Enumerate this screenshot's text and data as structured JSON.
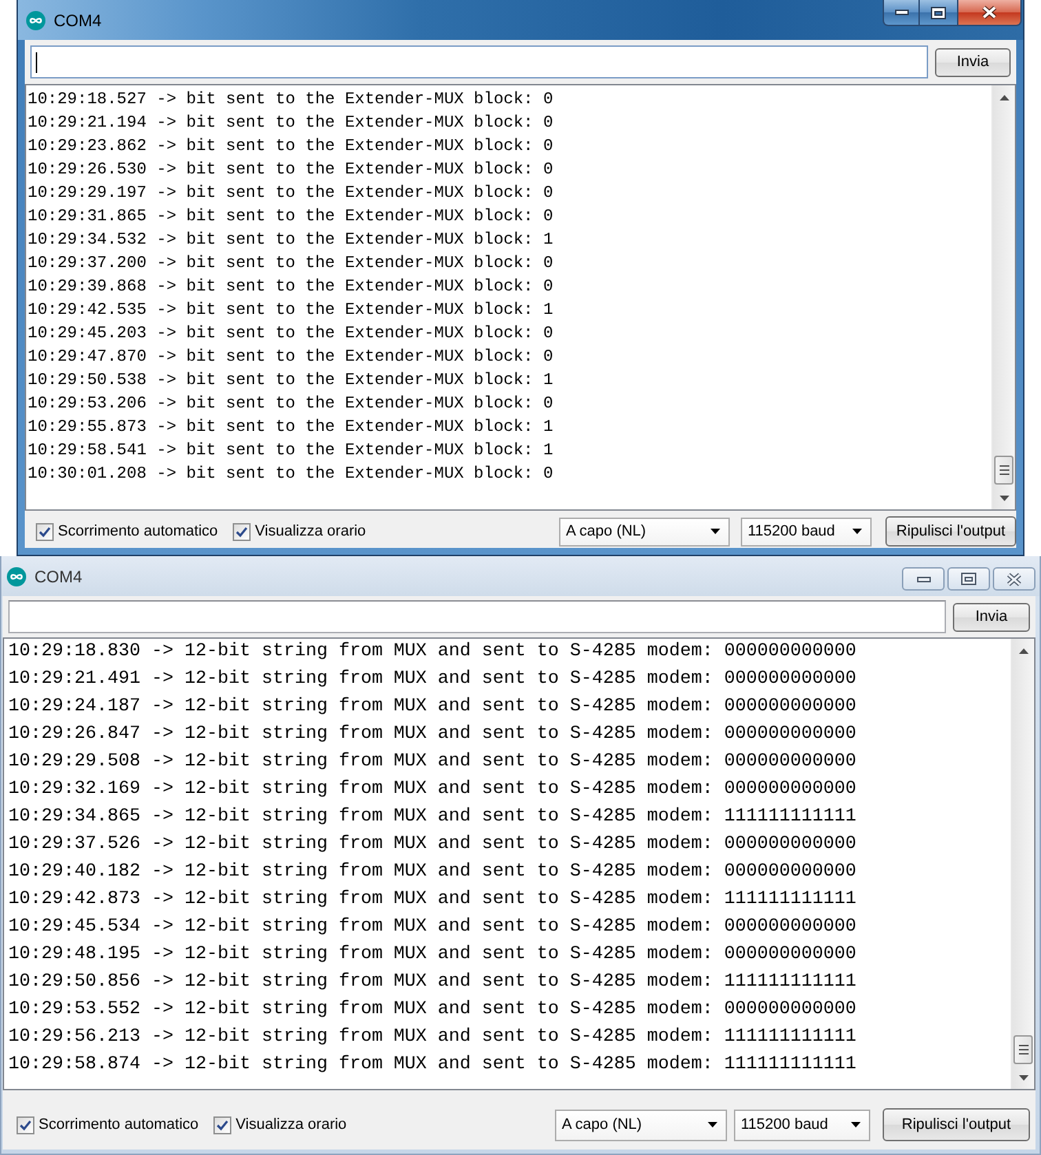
{
  "windows": [
    {
      "title": "COM4",
      "active": true,
      "input": {
        "focused": true
      },
      "send_button": "Invia",
      "output_lines": [
        "10:29:18.527 -> bit sent to the Extender-MUX block: 0",
        "10:29:21.194 -> bit sent to the Extender-MUX block: 0",
        "10:29:23.862 -> bit sent to the Extender-MUX block: 0",
        "10:29:26.530 -> bit sent to the Extender-MUX block: 0",
        "10:29:29.197 -> bit sent to the Extender-MUX block: 0",
        "10:29:31.865 -> bit sent to the Extender-MUX block: 0",
        "10:29:34.532 -> bit sent to the Extender-MUX block: 1",
        "10:29:37.200 -> bit sent to the Extender-MUX block: 0",
        "10:29:39.868 -> bit sent to the Extender-MUX block: 0",
        "10:29:42.535 -> bit sent to the Extender-MUX block: 1",
        "10:29:45.203 -> bit sent to the Extender-MUX block: 0",
        "10:29:47.870 -> bit sent to the Extender-MUX block: 0",
        "10:29:50.538 -> bit sent to the Extender-MUX block: 1",
        "10:29:53.206 -> bit sent to the Extender-MUX block: 0",
        "10:29:55.873 -> bit sent to the Extender-MUX block: 1",
        "10:29:58.541 -> bit sent to the Extender-MUX block: 1",
        "10:30:01.208 -> bit sent to the Extender-MUX block: 0"
      ],
      "autoscroll": {
        "label": "Scorrimento automatico",
        "checked": true
      },
      "show_timestamp": {
        "label": "Visualizza orario",
        "checked": true
      },
      "line_ending": "A capo (NL)",
      "baud_rate": "115200 baud",
      "clear_button": "Ripulisci l'output"
    },
    {
      "title": "COM4",
      "active": false,
      "input": {
        "focused": false
      },
      "send_button": "Invia",
      "output_lines": [
        "10:29:18.830 -> 12-bit string from MUX and sent to S-4285 modem: 000000000000",
        "10:29:21.491 -> 12-bit string from MUX and sent to S-4285 modem: 000000000000",
        "10:29:24.187 -> 12-bit string from MUX and sent to S-4285 modem: 000000000000",
        "10:29:26.847 -> 12-bit string from MUX and sent to S-4285 modem: 000000000000",
        "10:29:29.508 -> 12-bit string from MUX and sent to S-4285 modem: 000000000000",
        "10:29:32.169 -> 12-bit string from MUX and sent to S-4285 modem: 000000000000",
        "10:29:34.865 -> 12-bit string from MUX and sent to S-4285 modem: 111111111111",
        "10:29:37.526 -> 12-bit string from MUX and sent to S-4285 modem: 000000000000",
        "10:29:40.182 -> 12-bit string from MUX and sent to S-4285 modem: 000000000000",
        "10:29:42.873 -> 12-bit string from MUX and sent to S-4285 modem: 111111111111",
        "10:29:45.534 -> 12-bit string from MUX and sent to S-4285 modem: 000000000000",
        "10:29:48.195 -> 12-bit string from MUX and sent to S-4285 modem: 000000000000",
        "10:29:50.856 -> 12-bit string from MUX and sent to S-4285 modem: 111111111111",
        "10:29:53.552 -> 12-bit string from MUX and sent to S-4285 modem: 000000000000",
        "10:29:56.213 -> 12-bit string from MUX and sent to S-4285 modem: 111111111111",
        "10:29:58.874 -> 12-bit string from MUX and sent to S-4285 modem: 111111111111"
      ],
      "autoscroll": {
        "label": "Scorrimento automatico",
        "checked": true
      },
      "show_timestamp": {
        "label": "Visualizza orario",
        "checked": true
      },
      "line_ending": "A capo (NL)",
      "baud_rate": "115200 baud",
      "clear_button": "Ripulisci l'output"
    }
  ]
}
